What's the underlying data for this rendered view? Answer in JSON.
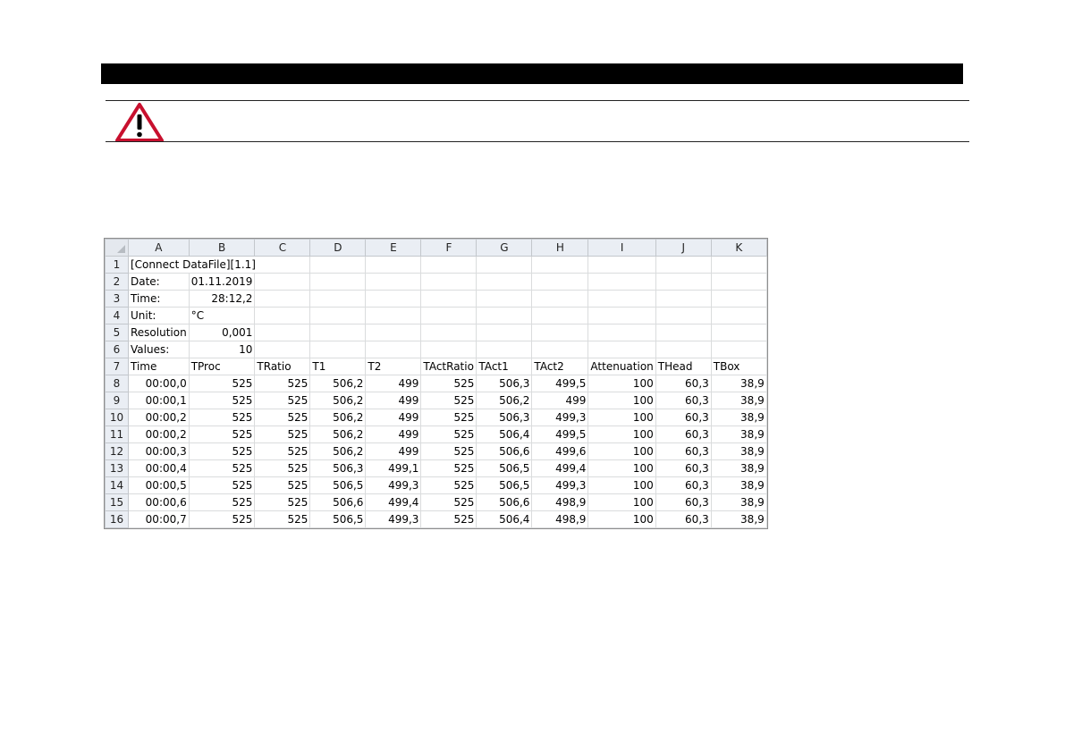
{
  "sheet": {
    "columns": [
      "A",
      "B",
      "C",
      "D",
      "E",
      "F",
      "G",
      "H",
      "I",
      "J",
      "K"
    ],
    "rows": [
      {
        "n": "1",
        "cells": [
          {
            "v": "[Connect DataFile][1.1]",
            "a": "txt",
            "span": 3
          }
        ]
      },
      {
        "n": "2",
        "cells": [
          {
            "v": "Date:",
            "a": "txt"
          },
          {
            "v": "01.11.2019",
            "a": "txt"
          },
          {
            "v": "",
            "a": "txt"
          },
          {
            "v": "",
            "a": "txt"
          },
          {
            "v": "",
            "a": "txt"
          },
          {
            "v": "",
            "a": "txt"
          },
          {
            "v": "",
            "a": "txt"
          },
          {
            "v": "",
            "a": "txt"
          },
          {
            "v": "",
            "a": "txt"
          },
          {
            "v": "",
            "a": "txt"
          },
          {
            "v": "",
            "a": "txt"
          }
        ]
      },
      {
        "n": "3",
        "cells": [
          {
            "v": "Time:",
            "a": "txt"
          },
          {
            "v": "28:12,2",
            "a": "num"
          },
          {
            "v": "",
            "a": "txt"
          },
          {
            "v": "",
            "a": "txt"
          },
          {
            "v": "",
            "a": "txt"
          },
          {
            "v": "",
            "a": "txt"
          },
          {
            "v": "",
            "a": "txt"
          },
          {
            "v": "",
            "a": "txt"
          },
          {
            "v": "",
            "a": "txt"
          },
          {
            "v": "",
            "a": "txt"
          },
          {
            "v": "",
            "a": "txt"
          }
        ]
      },
      {
        "n": "4",
        "cells": [
          {
            "v": "Unit:",
            "a": "txt"
          },
          {
            "v": "°C",
            "a": "txt"
          },
          {
            "v": "",
            "a": "txt"
          },
          {
            "v": "",
            "a": "txt"
          },
          {
            "v": "",
            "a": "txt"
          },
          {
            "v": "",
            "a": "txt"
          },
          {
            "v": "",
            "a": "txt"
          },
          {
            "v": "",
            "a": "txt"
          },
          {
            "v": "",
            "a": "txt"
          },
          {
            "v": "",
            "a": "txt"
          },
          {
            "v": "",
            "a": "txt"
          }
        ]
      },
      {
        "n": "5",
        "cells": [
          {
            "v": "Resolution",
            "a": "txt"
          },
          {
            "v": "0,001",
            "a": "num"
          },
          {
            "v": "",
            "a": "txt"
          },
          {
            "v": "",
            "a": "txt"
          },
          {
            "v": "",
            "a": "txt"
          },
          {
            "v": "",
            "a": "txt"
          },
          {
            "v": "",
            "a": "txt"
          },
          {
            "v": "",
            "a": "txt"
          },
          {
            "v": "",
            "a": "txt"
          },
          {
            "v": "",
            "a": "txt"
          },
          {
            "v": "",
            "a": "txt"
          }
        ]
      },
      {
        "n": "6",
        "cells": [
          {
            "v": "Values:",
            "a": "txt"
          },
          {
            "v": "10",
            "a": "num"
          },
          {
            "v": "",
            "a": "txt"
          },
          {
            "v": "",
            "a": "txt"
          },
          {
            "v": "",
            "a": "txt"
          },
          {
            "v": "",
            "a": "txt"
          },
          {
            "v": "",
            "a": "txt"
          },
          {
            "v": "",
            "a": "txt"
          },
          {
            "v": "",
            "a": "txt"
          },
          {
            "v": "",
            "a": "txt"
          },
          {
            "v": "",
            "a": "txt"
          }
        ]
      },
      {
        "n": "7",
        "cells": [
          {
            "v": "Time",
            "a": "txt"
          },
          {
            "v": "TProc",
            "a": "txt"
          },
          {
            "v": "TRatio",
            "a": "txt"
          },
          {
            "v": "T1",
            "a": "txt"
          },
          {
            "v": "T2",
            "a": "txt"
          },
          {
            "v": "TActRatio",
            "a": "txt"
          },
          {
            "v": "TAct1",
            "a": "txt"
          },
          {
            "v": "TAct2",
            "a": "txt"
          },
          {
            "v": "Attenuation",
            "a": "txt"
          },
          {
            "v": "THead",
            "a": "txt"
          },
          {
            "v": "TBox",
            "a": "txt"
          }
        ]
      },
      {
        "n": "8",
        "cells": [
          {
            "v": "00:00,0",
            "a": "num"
          },
          {
            "v": "525",
            "a": "num"
          },
          {
            "v": "525",
            "a": "num"
          },
          {
            "v": "506,2",
            "a": "num"
          },
          {
            "v": "499",
            "a": "num"
          },
          {
            "v": "525",
            "a": "num"
          },
          {
            "v": "506,3",
            "a": "num"
          },
          {
            "v": "499,5",
            "a": "num"
          },
          {
            "v": "100",
            "a": "num"
          },
          {
            "v": "60,3",
            "a": "num"
          },
          {
            "v": "38,9",
            "a": "num"
          }
        ]
      },
      {
        "n": "9",
        "cells": [
          {
            "v": "00:00,1",
            "a": "num"
          },
          {
            "v": "525",
            "a": "num"
          },
          {
            "v": "525",
            "a": "num"
          },
          {
            "v": "506,2",
            "a": "num"
          },
          {
            "v": "499",
            "a": "num"
          },
          {
            "v": "525",
            "a": "num"
          },
          {
            "v": "506,2",
            "a": "num"
          },
          {
            "v": "499",
            "a": "num"
          },
          {
            "v": "100",
            "a": "num"
          },
          {
            "v": "60,3",
            "a": "num"
          },
          {
            "v": "38,9",
            "a": "num"
          }
        ]
      },
      {
        "n": "10",
        "cells": [
          {
            "v": "00:00,2",
            "a": "num"
          },
          {
            "v": "525",
            "a": "num"
          },
          {
            "v": "525",
            "a": "num"
          },
          {
            "v": "506,2",
            "a": "num"
          },
          {
            "v": "499",
            "a": "num"
          },
          {
            "v": "525",
            "a": "num"
          },
          {
            "v": "506,3",
            "a": "num"
          },
          {
            "v": "499,3",
            "a": "num"
          },
          {
            "v": "100",
            "a": "num"
          },
          {
            "v": "60,3",
            "a": "num"
          },
          {
            "v": "38,9",
            "a": "num"
          }
        ]
      },
      {
        "n": "11",
        "cells": [
          {
            "v": "00:00,2",
            "a": "num"
          },
          {
            "v": "525",
            "a": "num"
          },
          {
            "v": "525",
            "a": "num"
          },
          {
            "v": "506,2",
            "a": "num"
          },
          {
            "v": "499",
            "a": "num"
          },
          {
            "v": "525",
            "a": "num"
          },
          {
            "v": "506,4",
            "a": "num"
          },
          {
            "v": "499,5",
            "a": "num"
          },
          {
            "v": "100",
            "a": "num"
          },
          {
            "v": "60,3",
            "a": "num"
          },
          {
            "v": "38,9",
            "a": "num"
          }
        ]
      },
      {
        "n": "12",
        "cells": [
          {
            "v": "00:00,3",
            "a": "num"
          },
          {
            "v": "525",
            "a": "num"
          },
          {
            "v": "525",
            "a": "num"
          },
          {
            "v": "506,2",
            "a": "num"
          },
          {
            "v": "499",
            "a": "num"
          },
          {
            "v": "525",
            "a": "num"
          },
          {
            "v": "506,6",
            "a": "num"
          },
          {
            "v": "499,6",
            "a": "num"
          },
          {
            "v": "100",
            "a": "num"
          },
          {
            "v": "60,3",
            "a": "num"
          },
          {
            "v": "38,9",
            "a": "num"
          }
        ]
      },
      {
        "n": "13",
        "cells": [
          {
            "v": "00:00,4",
            "a": "num"
          },
          {
            "v": "525",
            "a": "num"
          },
          {
            "v": "525",
            "a": "num"
          },
          {
            "v": "506,3",
            "a": "num"
          },
          {
            "v": "499,1",
            "a": "num"
          },
          {
            "v": "525",
            "a": "num"
          },
          {
            "v": "506,5",
            "a": "num"
          },
          {
            "v": "499,4",
            "a": "num"
          },
          {
            "v": "100",
            "a": "num"
          },
          {
            "v": "60,3",
            "a": "num"
          },
          {
            "v": "38,9",
            "a": "num"
          }
        ]
      },
      {
        "n": "14",
        "cells": [
          {
            "v": "00:00,5",
            "a": "num"
          },
          {
            "v": "525",
            "a": "num"
          },
          {
            "v": "525",
            "a": "num"
          },
          {
            "v": "506,5",
            "a": "num"
          },
          {
            "v": "499,3",
            "a": "num"
          },
          {
            "v": "525",
            "a": "num"
          },
          {
            "v": "506,5",
            "a": "num"
          },
          {
            "v": "499,3",
            "a": "num"
          },
          {
            "v": "100",
            "a": "num"
          },
          {
            "v": "60,3",
            "a": "num"
          },
          {
            "v": "38,9",
            "a": "num"
          }
        ]
      },
      {
        "n": "15",
        "cells": [
          {
            "v": "00:00,6",
            "a": "num"
          },
          {
            "v": "525",
            "a": "num"
          },
          {
            "v": "525",
            "a": "num"
          },
          {
            "v": "506,6",
            "a": "num"
          },
          {
            "v": "499,4",
            "a": "num"
          },
          {
            "v": "525",
            "a": "num"
          },
          {
            "v": "506,6",
            "a": "num"
          },
          {
            "v": "498,9",
            "a": "num"
          },
          {
            "v": "100",
            "a": "num"
          },
          {
            "v": "60,3",
            "a": "num"
          },
          {
            "v": "38,9",
            "a": "num"
          }
        ]
      },
      {
        "n": "16",
        "cells": [
          {
            "v": "00:00,7",
            "a": "num"
          },
          {
            "v": "525",
            "a": "num"
          },
          {
            "v": "525",
            "a": "num"
          },
          {
            "v": "506,5",
            "a": "num"
          },
          {
            "v": "499,3",
            "a": "num"
          },
          {
            "v": "525",
            "a": "num"
          },
          {
            "v": "506,4",
            "a": "num"
          },
          {
            "v": "498,9",
            "a": "num"
          },
          {
            "v": "100",
            "a": "num"
          },
          {
            "v": "60,3",
            "a": "num"
          },
          {
            "v": "38,9",
            "a": "num"
          }
        ]
      }
    ]
  },
  "icons": {
    "warning": "warning-triangle-icon"
  },
  "colors": {
    "warning_red": "#c8102e",
    "header_bg": "#eaeef4"
  }
}
